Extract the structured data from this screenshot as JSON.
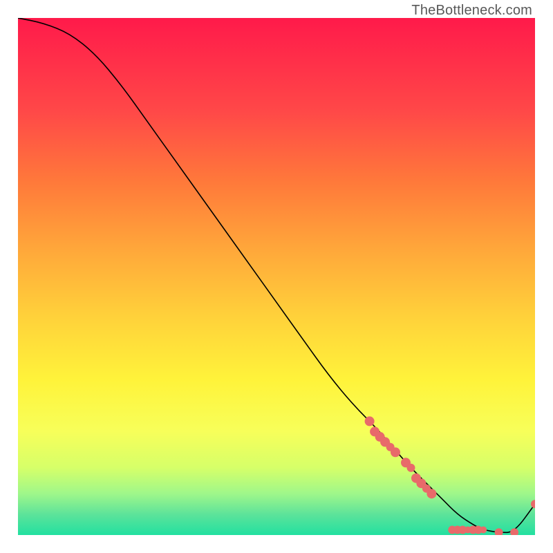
{
  "watermark_text": "TheBottleneck.com",
  "chart_data": {
    "type": "line",
    "title": "",
    "xlabel": "",
    "ylabel": "",
    "xlim": [
      0,
      100
    ],
    "ylim": [
      0,
      100
    ],
    "grid": false,
    "legend": false,
    "background_gradient": {
      "top": "#ff1a4a",
      "mid_upper": "#ff7a3a",
      "mid": "#fff33a",
      "mid_lower": "#9ff78a",
      "bottom": "#22e0a0"
    },
    "series": [
      {
        "name": "bottleneck-curve",
        "color": "#000000",
        "marker": "none",
        "x": [
          0,
          5,
          10,
          15,
          20,
          25,
          30,
          35,
          40,
          45,
          50,
          55,
          60,
          65,
          70,
          75,
          80,
          82,
          85,
          88,
          90,
          93,
          96,
          100
        ],
        "y": [
          100,
          99,
          97,
          93,
          87,
          80,
          73,
          66,
          59,
          52,
          45,
          38,
          31,
          25,
          20,
          14,
          9,
          7,
          4,
          2,
          1,
          0.5,
          0.5,
          6
        ]
      },
      {
        "name": "highlighted-points",
        "color": "#e86a6a",
        "marker": "circle",
        "points": [
          {
            "x": 68,
            "y": 22,
            "r": 7
          },
          {
            "x": 69,
            "y": 20,
            "r": 7
          },
          {
            "x": 70,
            "y": 19,
            "r": 7
          },
          {
            "x": 71,
            "y": 18,
            "r": 7
          },
          {
            "x": 72,
            "y": 17,
            "r": 6
          },
          {
            "x": 73,
            "y": 16,
            "r": 7
          },
          {
            "x": 75,
            "y": 14,
            "r": 7
          },
          {
            "x": 76,
            "y": 13,
            "r": 6
          },
          {
            "x": 77,
            "y": 11,
            "r": 7
          },
          {
            "x": 78,
            "y": 10,
            "r": 7
          },
          {
            "x": 79,
            "y": 9,
            "r": 6
          },
          {
            "x": 80,
            "y": 8,
            "r": 7
          },
          {
            "x": 84,
            "y": 1,
            "r": 6
          },
          {
            "x": 85,
            "y": 1,
            "r": 6
          },
          {
            "x": 86,
            "y": 1,
            "r": 6
          },
          {
            "x": 87,
            "y": 1,
            "r": 5
          },
          {
            "x": 88,
            "y": 1,
            "r": 6
          },
          {
            "x": 89,
            "y": 1,
            "r": 6
          },
          {
            "x": 90,
            "y": 1,
            "r": 5
          },
          {
            "x": 93,
            "y": 0.5,
            "r": 6
          },
          {
            "x": 96,
            "y": 0.5,
            "r": 6
          },
          {
            "x": 100,
            "y": 6,
            "r": 6
          }
        ]
      }
    ]
  }
}
